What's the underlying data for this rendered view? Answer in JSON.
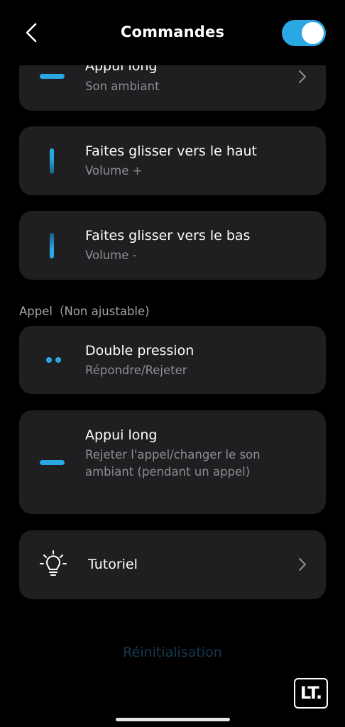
{
  "header": {
    "title": "Commandes",
    "back_icon": "chevron-left-icon",
    "toggle_on": true,
    "accent_color": "#2aa8e4"
  },
  "controls": [
    {
      "title": "Appui long",
      "subtitle": "Son ambiant",
      "icon": "long-press-dash-icon",
      "has_chevron": true
    },
    {
      "title": "Faites glisser vers le haut",
      "subtitle": "Volume +",
      "icon": "swipe-up-icon",
      "has_chevron": false
    },
    {
      "title": "Faites glisser vers le bas",
      "subtitle": "Volume -",
      "icon": "swipe-down-icon",
      "has_chevron": false
    }
  ],
  "call_section": {
    "label": "Appel（Non ajustable)",
    "items": [
      {
        "title": "Double pression",
        "subtitle": "Répondre/Rejeter",
        "icon": "double-tap-dots-icon"
      },
      {
        "title": "Appui long",
        "subtitle": "Rejeter l'appel/changer le son ambiant (pendant un appel)",
        "icon": "long-press-dash-icon"
      }
    ]
  },
  "tutorial": {
    "label": "Tutoriel",
    "icon": "lightbulb-icon"
  },
  "reset": {
    "label": "Réinitialisation"
  },
  "watermark": {
    "text": "LT."
  }
}
